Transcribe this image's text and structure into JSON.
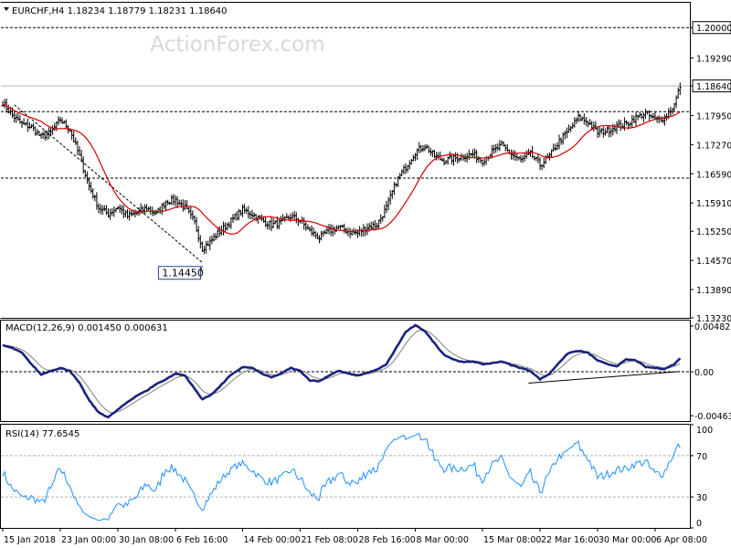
{
  "watermark": "ActionForex.com",
  "chart_data": [
    {
      "panel": "price",
      "type": "line",
      "title": "EURCHF,H4  1.18234 1.18779 1.18231 1.18640",
      "ylim": [
        1.1323,
        1.2058
      ],
      "y_ticks": [
        "1.20000",
        "1.19290",
        "1.18640",
        "1.17950",
        "1.17270",
        "1.16590",
        "1.15910",
        "1.15250",
        "1.14570",
        "1.13890",
        "1.13230"
      ],
      "x_ticks": [
        {
          "index": 0,
          "label": "15 Jan 2018"
        },
        {
          "index": 30,
          "label": "23 Jan 00:00"
        },
        {
          "index": 60,
          "label": "30 Jan 08:00"
        },
        {
          "index": 90,
          "label": "6 Feb 16:00"
        },
        {
          "index": 125,
          "label": "14 Feb 00:00"
        },
        {
          "index": 155,
          "label": "21 Feb 08:00"
        },
        {
          "index": 185,
          "label": "28 Feb 16:00"
        },
        {
          "index": 215,
          "label": "8 Mar 00:00"
        },
        {
          "index": 250,
          "label": "15 Mar 08:00"
        },
        {
          "index": 280,
          "label": "22 Mar 16:00"
        },
        {
          "index": 310,
          "label": "30 Mar 00:00"
        },
        {
          "index": 340,
          "label": "6 Apr 08:00"
        }
      ],
      "price_keys": [
        [
          0,
          1.1825
        ],
        [
          5,
          1.1795
        ],
        [
          10,
          1.1775
        ],
        [
          15,
          1.1768
        ],
        [
          20,
          1.1745
        ],
        [
          25,
          1.1755
        ],
        [
          30,
          1.1785
        ],
        [
          35,
          1.1762
        ],
        [
          40,
          1.17
        ],
        [
          45,
          1.163
        ],
        [
          50,
          1.158
        ],
        [
          55,
          1.1565
        ],
        [
          60,
          1.1582
        ],
        [
          65,
          1.156
        ],
        [
          70,
          1.1568
        ],
        [
          75,
          1.158
        ],
        [
          80,
          1.1565
        ],
        [
          85,
          1.1595
        ],
        [
          90,
          1.1598
        ],
        [
          95,
          1.158
        ],
        [
          100,
          1.1545
        ],
        [
          104,
          1.1485
        ],
        [
          108,
          1.15
        ],
        [
          112,
          1.152
        ],
        [
          118,
          1.1545
        ],
        [
          125,
          1.1575
        ],
        [
          130,
          1.1565
        ],
        [
          135,
          1.155
        ],
        [
          140,
          1.154
        ],
        [
          145,
          1.1545
        ],
        [
          150,
          1.156
        ],
        [
          155,
          1.155
        ],
        [
          160,
          1.1525
        ],
        [
          165,
          1.151
        ],
        [
          170,
          1.1525
        ],
        [
          175,
          1.1535
        ],
        [
          180,
          1.1525
        ],
        [
          185,
          1.152
        ],
        [
          190,
          1.1535
        ],
        [
          195,
          1.154
        ],
        [
          200,
          1.158
        ],
        [
          205,
          1.164
        ],
        [
          210,
          1.1675
        ],
        [
          215,
          1.171
        ],
        [
          220,
          1.1725
        ],
        [
          225,
          1.17
        ],
        [
          230,
          1.169
        ],
        [
          235,
          1.1695
        ],
        [
          240,
          1.17
        ],
        [
          245,
          1.1705
        ],
        [
          250,
          1.169
        ],
        [
          255,
          1.171
        ],
        [
          260,
          1.1725
        ],
        [
          265,
          1.1705
        ],
        [
          270,
          1.169
        ],
        [
          275,
          1.1705
        ],
        [
          280,
          1.168
        ],
        [
          285,
          1.17
        ],
        [
          290,
          1.1735
        ],
        [
          295,
          1.176
        ],
        [
          300,
          1.179
        ],
        [
          305,
          1.178
        ],
        [
          310,
          1.1755
        ],
        [
          315,
          1.176
        ],
        [
          320,
          1.177
        ],
        [
          325,
          1.1775
        ],
        [
          330,
          1.179
        ],
        [
          335,
          1.18
        ],
        [
          340,
          1.1785
        ],
        [
          345,
          1.179
        ],
        [
          350,
          1.182
        ],
        [
          353,
          1.1864
        ]
      ],
      "series": [
        {
          "name": "",
          "color": "#000000",
          "role": "price-bars"
        },
        {
          "name": "",
          "color": "#d40000",
          "role": "moving-average"
        }
      ],
      "levels": [
        {
          "value": 1.2,
          "label": "1.20000"
        },
        {
          "value": 1.1864,
          "label": "1.18640"
        },
        {
          "value": 1.1804,
          "label": "1.18040"
        },
        {
          "value": 1.1649,
          "label": "1.16490"
        }
      ],
      "low_label": {
        "index": 104,
        "value": 1.1445,
        "label": "1.14450"
      },
      "trendline": {
        "from": [
          6,
          1.182
        ],
        "to": [
          104,
          1.1452
        ]
      }
    },
    {
      "panel": "macd",
      "type": "line",
      "title": "MACD(12,26,9) 0.001450 0.000631",
      "ylim": [
        -0.0052,
        0.0054
      ],
      "y_ticks": [
        "0.004827",
        "0.00",
        "-0.004632"
      ],
      "tick_values": [
        0.004827,
        0,
        -0.004632
      ],
      "macd_keys": [
        [
          0,
          0.0028
        ],
        [
          5,
          0.0025
        ],
        [
          10,
          0.002
        ],
        [
          15,
          0.0008
        ],
        [
          20,
          -0.0003
        ],
        [
          25,
          0.0001
        ],
        [
          30,
          0.0004
        ],
        [
          35,
          0.0001
        ],
        [
          40,
          -0.0012
        ],
        [
          45,
          -0.003
        ],
        [
          50,
          -0.0043
        ],
        [
          55,
          -0.0048
        ],
        [
          60,
          -0.004
        ],
        [
          65,
          -0.0032
        ],
        [
          70,
          -0.0025
        ],
        [
          75,
          -0.002
        ],
        [
          80,
          -0.0013
        ],
        [
          85,
          -0.0008
        ],
        [
          90,
          -0.0002
        ],
        [
          95,
          -0.0004
        ],
        [
          100,
          -0.0018
        ],
        [
          104,
          -0.0029
        ],
        [
          108,
          -0.0025
        ],
        [
          112,
          -0.0018
        ],
        [
          118,
          -0.0005
        ],
        [
          125,
          0.0005
        ],
        [
          130,
          0.0004
        ],
        [
          135,
          -0.0002
        ],
        [
          140,
          -0.0006
        ],
        [
          145,
          -0.0002
        ],
        [
          150,
          0.0004
        ],
        [
          155,
          0.0001
        ],
        [
          160,
          -0.0009
        ],
        [
          165,
          -0.001
        ],
        [
          170,
          -0.0004
        ],
        [
          175,
          0.0001
        ],
        [
          180,
          -0.0002
        ],
        [
          185,
          -0.0004
        ],
        [
          190,
          -0.0001
        ],
        [
          195,
          0.0002
        ],
        [
          200,
          0.0008
        ],
        [
          205,
          0.0025
        ],
        [
          210,
          0.0042
        ],
        [
          215,
          0.0049
        ],
        [
          220,
          0.0043
        ],
        [
          225,
          0.003
        ],
        [
          230,
          0.0018
        ],
        [
          235,
          0.0013
        ],
        [
          240,
          0.001
        ],
        [
          245,
          0.0011
        ],
        [
          250,
          0.0008
        ],
        [
          255,
          0.0009
        ],
        [
          260,
          0.0011
        ],
        [
          265,
          0.0007
        ],
        [
          270,
          0.0004
        ],
        [
          275,
          0.0001
        ],
        [
          280,
          -0.0008
        ],
        [
          285,
          -0.0002
        ],
        [
          290,
          0.001
        ],
        [
          295,
          0.002
        ],
        [
          300,
          0.0022
        ],
        [
          305,
          0.002
        ],
        [
          310,
          0.0012
        ],
        [
          315,
          0.0008
        ],
        [
          320,
          0.0006
        ],
        [
          325,
          0.0013
        ],
        [
          330,
          0.0012
        ],
        [
          335,
          0.0005
        ],
        [
          340,
          0.0004
        ],
        [
          345,
          0.0003
        ],
        [
          350,
          0.0008
        ],
        [
          353,
          0.00145
        ]
      ],
      "series": [
        {
          "name": "",
          "color": "#1a237e",
          "role": "macd"
        },
        {
          "name": "",
          "color": "#808080",
          "role": "signal"
        }
      ],
      "trendline": {
        "from": [
          274,
          -0.0012
        ],
        "to": [
          353,
          3e-05
        ]
      }
    },
    {
      "panel": "rsi",
      "type": "line",
      "title": "RSI(14) 77.6545",
      "ylim": [
        0,
        100
      ],
      "y_ticks": [
        "100",
        "70",
        "30",
        "0"
      ],
      "tick_values": [
        100,
        70,
        30,
        0
      ],
      "levels": [
        70,
        30
      ],
      "series": [
        {
          "name": "",
          "color": "#1e90ff",
          "role": "rsi"
        }
      ]
    }
  ]
}
